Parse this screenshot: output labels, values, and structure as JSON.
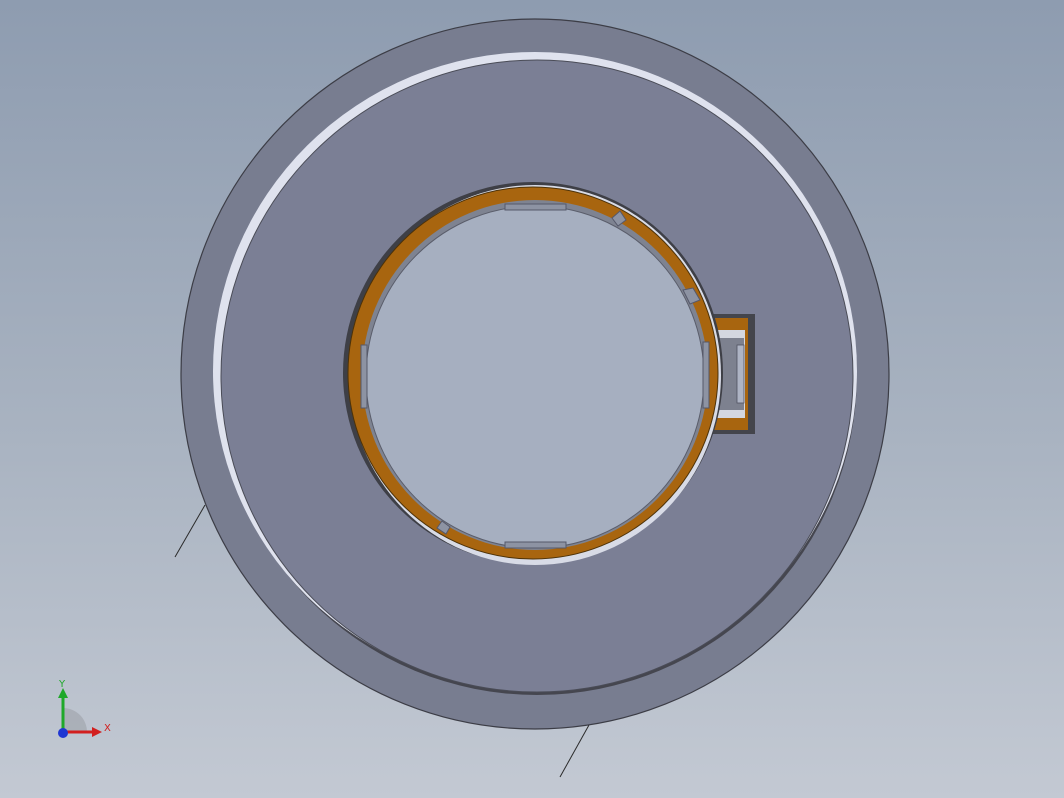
{
  "viewport": {
    "background_top": "#8e9cb0",
    "background_bottom": "#c3c9d3"
  },
  "model": {
    "colors": {
      "outer_face": "#787d90",
      "inner_face": "#7b7f95",
      "bore": "#a6afc0",
      "retaining_ring": "#a8650f",
      "edge_highlight": "#dde0ec",
      "shadow_edge": "#45464f"
    }
  },
  "triad": {
    "x_label": "X",
    "y_label": "Y",
    "x_color": "#d21f1f",
    "y_color": "#1fa82a",
    "z_color": "#1f36d2"
  }
}
